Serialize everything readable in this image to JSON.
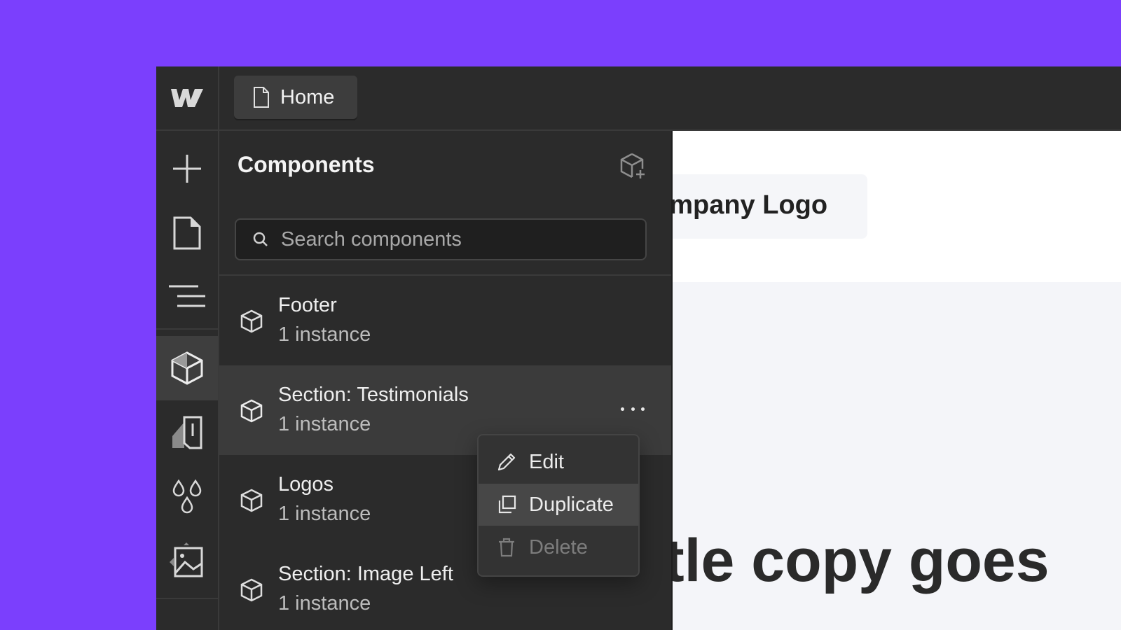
{
  "topbar": {
    "page_label": "Home"
  },
  "rail": {
    "items": [
      {
        "icon": "plus-icon"
      },
      {
        "icon": "page-icon"
      },
      {
        "icon": "navigator-icon"
      },
      {
        "icon": "component-icon",
        "active": true
      },
      {
        "icon": "style-selector-icon"
      },
      {
        "icon": "swatches-icon"
      },
      {
        "icon": "assets-icon"
      }
    ]
  },
  "panel": {
    "title": "Components",
    "search_placeholder": "Search components",
    "items": [
      {
        "name": "Footer",
        "count": "1 instance"
      },
      {
        "name": "Section: Testimonials",
        "count": "1 instance",
        "hovered": true
      },
      {
        "name": "Logos",
        "count": "1 instance"
      },
      {
        "name": "Section: Image Left",
        "count": "1 instance"
      }
    ]
  },
  "context_menu": {
    "items": [
      {
        "label": "Edit",
        "icon": "pencil-icon"
      },
      {
        "label": "Duplicate",
        "icon": "duplicate-icon",
        "highlighted": true
      },
      {
        "label": "Delete",
        "icon": "trash-icon",
        "disabled": true
      }
    ]
  },
  "canvas": {
    "logo_text": "ompany Logo",
    "headline": "tle copy goes"
  },
  "colors": {
    "background": "#7b3ffd",
    "panel": "#2b2b2b",
    "hover": "#3b3b3b",
    "canvas": "#f4f5f9"
  }
}
